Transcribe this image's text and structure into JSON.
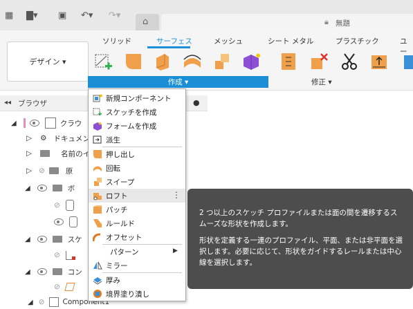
{
  "app": {
    "document_title": "無題"
  },
  "ribbon": {
    "tabs": [
      {
        "label": "ソリッド"
      },
      {
        "label": "サーフェス"
      },
      {
        "label": "メッシュ"
      },
      {
        "label": "シート メタル"
      },
      {
        "label": "プラスチック"
      },
      {
        "label": "ユー"
      }
    ],
    "active_tab": "サーフェス",
    "design_button": "デザイン ▾",
    "create_group": "作成 ▾",
    "modify_group": "修正 ▾"
  },
  "browser": {
    "title": "ブラウザ",
    "rows": [
      {
        "label": "クラウ"
      },
      {
        "label": "ドキュメン"
      },
      {
        "label": "名前のイ"
      },
      {
        "label": "原"
      },
      {
        "label": "ボ"
      },
      {
        "label": "スケ"
      },
      {
        "label": "コン"
      },
      {
        "label": "Component1"
      }
    ]
  },
  "menu": {
    "items": [
      {
        "label": "新規コンポーネント",
        "icon": "new-component-icon"
      },
      {
        "label": "スケッチを作成",
        "icon": "create-sketch-icon"
      },
      {
        "label": "フォームを作成",
        "icon": "create-form-icon"
      },
      {
        "label": "派生",
        "icon": "derive-icon"
      },
      {
        "label": "押し出し",
        "icon": "extrude-icon"
      },
      {
        "label": "回転",
        "icon": "revolve-icon"
      },
      {
        "label": "スイープ",
        "icon": "sweep-icon"
      },
      {
        "label": "ロフト",
        "icon": "loft-icon",
        "highlighted": true
      },
      {
        "label": "パッチ",
        "icon": "patch-icon"
      },
      {
        "label": "ルールド",
        "icon": "ruled-icon"
      },
      {
        "label": "オフセット",
        "icon": "offset-icon"
      },
      {
        "label": "パターン",
        "icon": "pattern-icon"
      },
      {
        "label": "ミラー",
        "icon": "mirror-icon"
      },
      {
        "label": "厚み",
        "icon": "thicken-icon"
      },
      {
        "label": "境界塗り潰し",
        "icon": "boundary-fill-icon"
      }
    ],
    "more_glyph": "⋮",
    "submenu_glyph": "▶"
  },
  "tooltip": {
    "line1": "2 つ以上のスケッチ プロファイルまたは面の間を遷移するスムーズな形状を作成します。",
    "line2": "形状を定義する一連のプロファイル、平面、または非平面を選択します。必要に応じて、形状をガイドするレールまたは中心線を選択します。"
  },
  "colors": {
    "accent": "#1a8fd8",
    "orange": "#f0a04b",
    "tooltip_bg": "#4d4d4d"
  }
}
